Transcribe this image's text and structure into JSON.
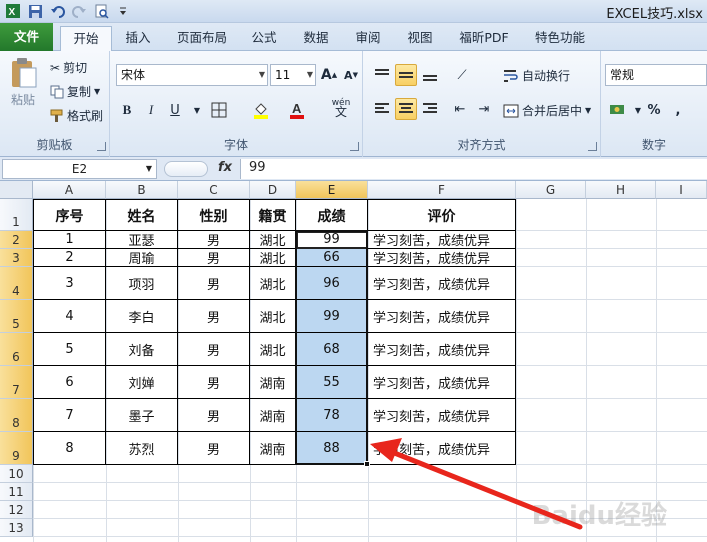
{
  "window": {
    "title": "EXCEL技巧.xlsx"
  },
  "tabs": [
    "文件",
    "开始",
    "插入",
    "页面布局",
    "公式",
    "数据",
    "审阅",
    "视图",
    "福昕PDF",
    "特色功能"
  ],
  "ribbon": {
    "clipboard": {
      "label": "剪贴板",
      "paste": "粘贴",
      "cut": "剪切",
      "copy": "复制",
      "format_painter": "格式刷"
    },
    "font": {
      "label": "字体",
      "name": "宋体",
      "size": "11",
      "bold": "B",
      "italic": "I",
      "underline": "U",
      "grow": "A",
      "shrink": "A",
      "font_color": "A",
      "phonetic": "wén"
    },
    "alignment": {
      "label": "对齐方式",
      "wrap": "自动换行",
      "merge": "合并后居中"
    },
    "number": {
      "label": "数字",
      "format": "常规",
      "percent": "%"
    }
  },
  "formula_bar": {
    "name_box": "E2",
    "fx": "fx",
    "value": "99"
  },
  "columns": [
    "A",
    "B",
    "C",
    "D",
    "E",
    "F",
    "G",
    "H",
    "I"
  ],
  "rows": [
    "1",
    "2",
    "3",
    "4",
    "5",
    "6",
    "7",
    "8",
    "9",
    "10",
    "11",
    "12",
    "13"
  ],
  "table": {
    "headers": [
      "序号",
      "姓名",
      "性别",
      "籍贯",
      "成绩",
      "评价"
    ],
    "rows": [
      [
        "1",
        "亚瑟",
        "男",
        "湖北",
        "99",
        "学习刻苦，成绩优异"
      ],
      [
        "2",
        "周瑜",
        "男",
        "湖北",
        "66",
        "学习刻苦，成绩优异"
      ],
      [
        "3",
        "项羽",
        "男",
        "湖北",
        "96",
        "学习刻苦，成绩优异"
      ],
      [
        "4",
        "李白",
        "男",
        "湖北",
        "99",
        "学习刻苦，成绩优异"
      ],
      [
        "5",
        "刘备",
        "男",
        "湖北",
        "68",
        "学习刻苦，成绩优异"
      ],
      [
        "6",
        "刘婵",
        "男",
        "湖南",
        "55",
        "学习刻苦，成绩优异"
      ],
      [
        "7",
        "墨子",
        "男",
        "湖南",
        "78",
        "学习刻苦，成绩优异"
      ],
      [
        "8",
        "苏烈",
        "男",
        "湖南",
        "88",
        "学习刻苦，成绩优异"
      ]
    ]
  },
  "colors": {
    "accent_green": "#2b8a34",
    "selection_blue": "#bcd7f1",
    "arrow_red": "#e8261c"
  },
  "watermark": "Baidu经验"
}
